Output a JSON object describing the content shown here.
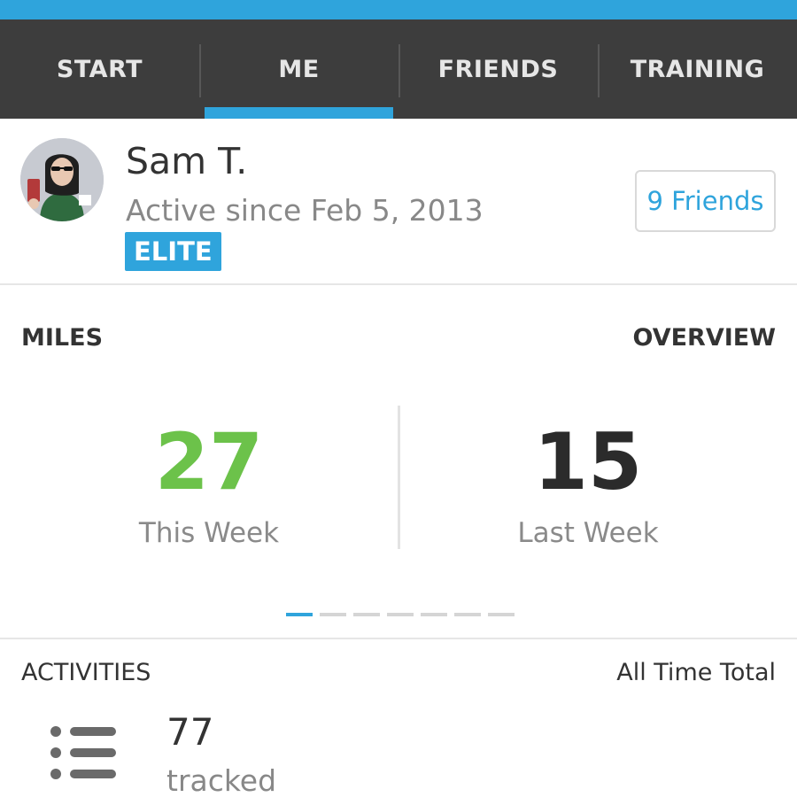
{
  "tabs": [
    {
      "label": "START"
    },
    {
      "label": "ME"
    },
    {
      "label": "FRIENDS"
    },
    {
      "label": "TRAINING"
    }
  ],
  "selected_tab": "ME",
  "profile": {
    "name": "Sam T.",
    "active_since": "Active since Feb 5, 2013",
    "badge": "ELITE",
    "friends_button": "9 Friends"
  },
  "miles": {
    "title": "MILES",
    "overview_label": "OVERVIEW",
    "this_week": {
      "value": "27",
      "label": "This Week"
    },
    "last_week": {
      "value": "15",
      "label": "Last Week"
    },
    "pager": {
      "pages": 7,
      "current": 1
    }
  },
  "activities": {
    "title": "ACTIVITIES",
    "meta": "All Time Total",
    "count": "77",
    "count_label": "tracked",
    "icon": "list-icon"
  },
  "colors": {
    "accent": "#2fa4dc",
    "highlight_green": "#6cc24a",
    "tab_bar": "#3d3d3d"
  }
}
